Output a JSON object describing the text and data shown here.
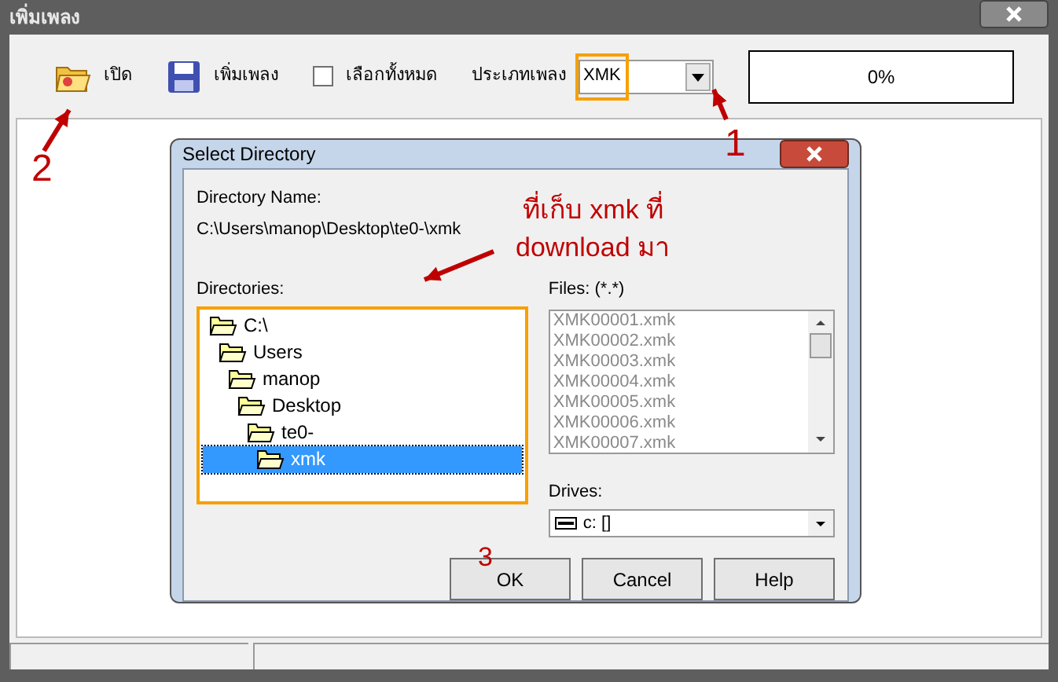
{
  "window": {
    "title": "เพิ่มเพลง"
  },
  "toolbar": {
    "open_button": "เปิด",
    "add_button": "เพิ่มเพลง",
    "select_all": {
      "label": "เลือกทั้งหมด",
      "checked": false
    },
    "type_label": "ประเภทเพลง",
    "type_select": {
      "value": "XMK"
    },
    "progress": "0%"
  },
  "dialog": {
    "title": "Select Directory",
    "directory_name_label": "Directory Name:",
    "directory_path": "C:\\Users\\manop\\Desktop\\te0-\\xmk",
    "directories_label": "Directories:",
    "tree": [
      {
        "label": "C:\\",
        "selected": false,
        "children": [
          {
            "label": "Users",
            "selected": false,
            "children": [
              {
                "label": "manop",
                "selected": false,
                "children": [
                  {
                    "label": "Desktop",
                    "selected": false,
                    "children": [
                      {
                        "label": "te0-",
                        "selected": false,
                        "children": [
                          {
                            "label": "xmk",
                            "selected": true
                          }
                        ]
                      }
                    ]
                  }
                ]
              }
            ]
          }
        ]
      }
    ],
    "files_label": "Files: (*.*)",
    "files": [
      "XMK00001.xmk",
      "XMK00002.xmk",
      "XMK00003.xmk",
      "XMK00004.xmk",
      "XMK00005.xmk",
      "XMK00006.xmk",
      "XMK00007.xmk"
    ],
    "drives_label": "Drives:",
    "drive": "c: []",
    "buttons": [
      "OK",
      "Cancel",
      "Help"
    ]
  },
  "annotations": {
    "numbers": [
      "1",
      "2",
      "3"
    ],
    "note": [
      "ที่เก็บ xmk ที่",
      "download มา"
    ]
  }
}
